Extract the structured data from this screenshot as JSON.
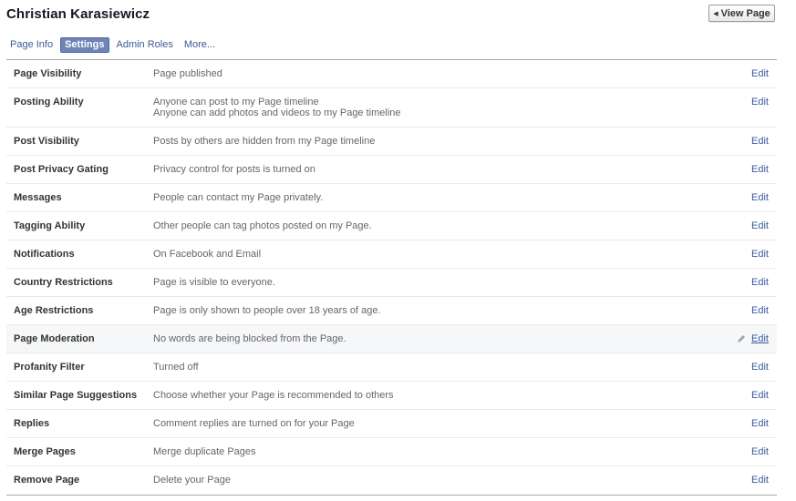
{
  "header": {
    "title": "Christian Karasiewicz",
    "view_page_label": "View Page"
  },
  "tabs": [
    {
      "label": "Page Info",
      "active": false
    },
    {
      "label": "Settings",
      "active": true
    },
    {
      "label": "Admin Roles",
      "active": false
    },
    {
      "label": "More...",
      "active": false
    }
  ],
  "edit_label": "Edit",
  "settings": [
    {
      "label": "Page Visibility",
      "values": [
        "Page published"
      ]
    },
    {
      "label": "Posting Ability",
      "values": [
        "Anyone can post to my Page timeline",
        "Anyone can add photos and videos to my Page timeline"
      ]
    },
    {
      "label": "Post Visibility",
      "values": [
        "Posts by others are hidden from my Page timeline"
      ]
    },
    {
      "label": "Post Privacy Gating",
      "values": [
        "Privacy control for posts is turned on"
      ]
    },
    {
      "label": "Messages",
      "values": [
        "People can contact my Page privately."
      ]
    },
    {
      "label": "Tagging Ability",
      "values": [
        "Other people can tag photos posted on my Page."
      ]
    },
    {
      "label": "Notifications",
      "values": [
        "On Facebook and Email"
      ]
    },
    {
      "label": "Country Restrictions",
      "values": [
        "Page is visible to everyone."
      ]
    },
    {
      "label": "Age Restrictions",
      "values": [
        "Page is only shown to people over 18 years of age."
      ]
    },
    {
      "label": "Page Moderation",
      "values": [
        "No words are being blocked from the Page."
      ]
    },
    {
      "label": "Profanity Filter",
      "values": [
        "Turned off"
      ]
    },
    {
      "label": "Similar Page Suggestions",
      "values": [
        "Choose whether your Page is recommended to others"
      ]
    },
    {
      "label": "Replies",
      "values": [
        "Comment replies are turned on for your Page"
      ]
    },
    {
      "label": "Merge Pages",
      "values": [
        "Merge duplicate Pages"
      ]
    },
    {
      "label": "Remove Page",
      "values": [
        "Delete your Page"
      ]
    }
  ],
  "hovered_row": "Page Moderation",
  "colors": {
    "link": "#3b5998",
    "tab_active_bg": "#6d84b4",
    "hover_row_bg": "#f6f7f9"
  }
}
